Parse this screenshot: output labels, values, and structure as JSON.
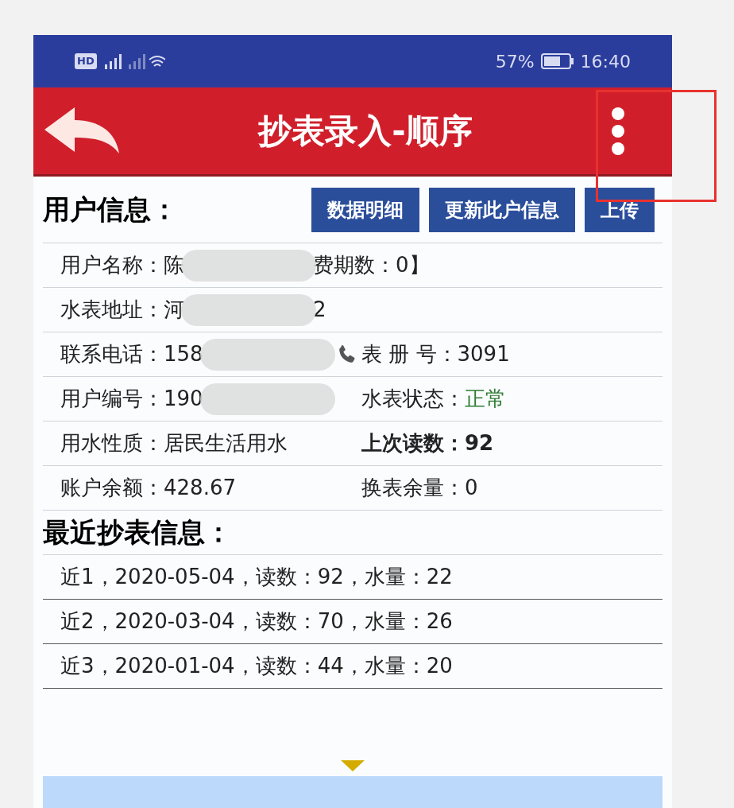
{
  "status_bar": {
    "left": "HD",
    "battery": "57%",
    "time": "16:40"
  },
  "header": {
    "title": "抄表录入-顺序"
  },
  "user_info": {
    "title": "用户信息：",
    "buttons": [
      "数据明细",
      "更新此户信息",
      "上传"
    ],
    "rows": [
      [
        {
          "kind": "masked",
          "label": "用户名称：",
          "before": "陈",
          "after": "费期数：0】"
        }
      ],
      [
        {
          "kind": "masked",
          "label": "水表地址：",
          "before": "河",
          "after": "2"
        }
      ],
      [
        {
          "kind": "masked",
          "label": "联系电话：",
          "before": "158",
          "phone": true
        },
        {
          "kind": "text",
          "label": "表 册 号：",
          "value": "3091"
        }
      ],
      [
        {
          "kind": "masked",
          "label": "用户编号：",
          "before": "190"
        },
        {
          "kind": "text",
          "label": "水表状态：",
          "value": "正常",
          "highlight": true
        }
      ],
      [
        {
          "kind": "text",
          "label": "用水性质：",
          "value": "居民生活用水"
        },
        {
          "kind": "text",
          "label": "上次读数：",
          "value": "92",
          "emphasis": true
        }
      ],
      [
        {
          "kind": "text",
          "label": "账户余额：",
          "value": "428.67"
        },
        {
          "kind": "text",
          "label": "换表余量：",
          "value": "0"
        }
      ]
    ]
  },
  "recent": {
    "title": "最近抄表信息：",
    "rows": [
      "近1，2020-05-04，读数：92，水量：22",
      "近2，2020-03-04，读数：70，水量：26",
      "近3，2020-01-04，读数：44，水量：20"
    ]
  }
}
